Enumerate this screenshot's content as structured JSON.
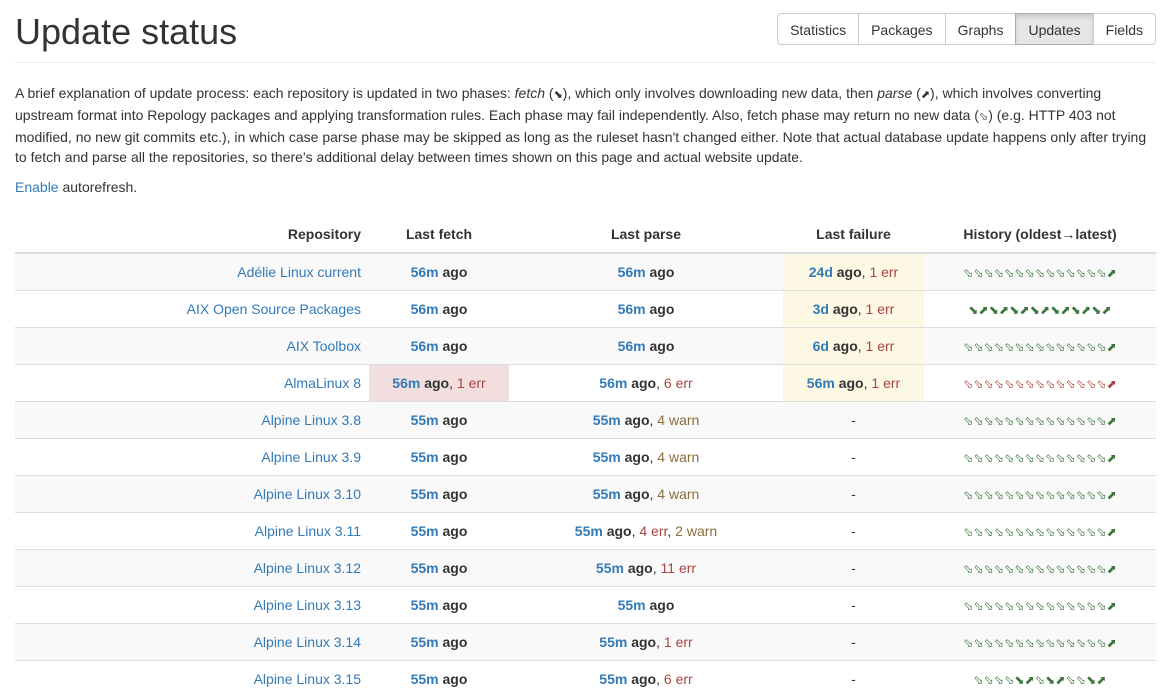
{
  "header": {
    "title": "Update status",
    "nav": [
      {
        "label": "Statistics",
        "active": false
      },
      {
        "label": "Packages",
        "active": false
      },
      {
        "label": "Graphs",
        "active": false
      },
      {
        "label": "Updates",
        "active": true
      },
      {
        "label": "Fields",
        "active": false
      }
    ]
  },
  "intro": {
    "p1": "A brief explanation of update process: each repository is updated in two phases: ",
    "fetch": "fetch",
    "p2": " (",
    "fetch_glyph": "⬊",
    "p3": "), which only involves downloading new data, then ",
    "parse": "parse",
    "p4": " (",
    "parse_glyph": "⬈",
    "p5": "), which involves converting upstream format into Repology packages and applying transformation rules. Each phase may fail independently. Also, fetch phase may return no new data (",
    "nodata_glyph": "⬂",
    "p6": ") (e.g. HTTP 403 not modified, no new git commits etc.), in which case parse phase may be skipped as long as the ruleset hasn't changed either. Note that actual database update happens only after trying to fetch and parse all the repositories, so there's additional delay between times shown on this page and actual website update."
  },
  "autorefresh": {
    "link": "Enable",
    "text": " autorefresh."
  },
  "table": {
    "headers": {
      "repo": "Repository",
      "fetch": "Last fetch",
      "parse": "Last parse",
      "failure": "Last failure",
      "history": "History (oldest→latest)"
    },
    "ago": "ago",
    "dash": "-",
    "rows": [
      {
        "repo": "Adélie Linux current",
        "fetch": {
          "t": "56m",
          "extra": []
        },
        "parse": {
          "t": "56m",
          "extra": []
        },
        "failure": {
          "t": "24d",
          "extra": [
            {
              "text": "1 err",
              "kind": "err"
            }
          ]
        },
        "failure_state": "warn",
        "fetch_state": "",
        "history": "⬂⬂⬂⬂⬂⬂⬂⬂⬂⬂⬂⬂⬂⬂⬈",
        "history_color": "ok"
      },
      {
        "repo": "AIX Open Source Packages",
        "fetch": {
          "t": "56m",
          "extra": []
        },
        "parse": {
          "t": "56m",
          "extra": []
        },
        "failure": {
          "t": "3d",
          "extra": [
            {
              "text": "1 err",
              "kind": "err"
            }
          ]
        },
        "failure_state": "warn",
        "fetch_state": "",
        "history": "⬊⬈⬊⬈⬊⬈⬊⬈⬊⬈⬊⬈⬊⬈",
        "history_color": "ok"
      },
      {
        "repo": "AIX Toolbox",
        "fetch": {
          "t": "56m",
          "extra": []
        },
        "parse": {
          "t": "56m",
          "extra": []
        },
        "failure": {
          "t": "6d",
          "extra": [
            {
              "text": "1 err",
              "kind": "err"
            }
          ]
        },
        "failure_state": "warn",
        "fetch_state": "",
        "history": "⬂⬂⬂⬂⬂⬂⬂⬂⬂⬂⬂⬂⬂⬂⬈",
        "history_color": "ok"
      },
      {
        "repo": "AlmaLinux 8",
        "fetch": {
          "t": "56m",
          "extra": [
            {
              "text": "1 err",
              "kind": "err"
            }
          ]
        },
        "parse": {
          "t": "56m",
          "extra": [
            {
              "text": "6 err",
              "kind": "err"
            }
          ]
        },
        "failure": {
          "t": "56m",
          "extra": [
            {
              "text": "1 err",
              "kind": "err"
            }
          ]
        },
        "failure_state": "warn",
        "fetch_state": "danger",
        "history": "⬂⬂⬂⬂⬂⬂⬂⬂⬂⬂⬂⬂⬂⬂⬈",
        "history_color": "bad"
      },
      {
        "repo": "Alpine Linux 3.8",
        "fetch": {
          "t": "55m",
          "extra": []
        },
        "parse": {
          "t": "55m",
          "extra": [
            {
              "text": "4 warn",
              "kind": "warn"
            }
          ]
        },
        "failure": null,
        "failure_state": "",
        "fetch_state": "",
        "history": "⬂⬂⬂⬂⬂⬂⬂⬂⬂⬂⬂⬂⬂⬂⬈",
        "history_color": "ok"
      },
      {
        "repo": "Alpine Linux 3.9",
        "fetch": {
          "t": "55m",
          "extra": []
        },
        "parse": {
          "t": "55m",
          "extra": [
            {
              "text": "4 warn",
              "kind": "warn"
            }
          ]
        },
        "failure": null,
        "failure_state": "",
        "fetch_state": "",
        "history": "⬂⬂⬂⬂⬂⬂⬂⬂⬂⬂⬂⬂⬂⬂⬈",
        "history_color": "ok"
      },
      {
        "repo": "Alpine Linux 3.10",
        "fetch": {
          "t": "55m",
          "extra": []
        },
        "parse": {
          "t": "55m",
          "extra": [
            {
              "text": "4 warn",
              "kind": "warn"
            }
          ]
        },
        "failure": null,
        "failure_state": "",
        "fetch_state": "",
        "history": "⬂⬂⬂⬂⬂⬂⬂⬂⬂⬂⬂⬂⬂⬂⬈",
        "history_color": "ok"
      },
      {
        "repo": "Alpine Linux 3.11",
        "fetch": {
          "t": "55m",
          "extra": []
        },
        "parse": {
          "t": "55m",
          "extra": [
            {
              "text": "4 err",
              "kind": "err"
            },
            {
              "text": "2 warn",
              "kind": "warn"
            }
          ]
        },
        "failure": null,
        "failure_state": "",
        "fetch_state": "",
        "history": "⬂⬂⬂⬂⬂⬂⬂⬂⬂⬂⬂⬂⬂⬂⬈",
        "history_color": "ok"
      },
      {
        "repo": "Alpine Linux 3.12",
        "fetch": {
          "t": "55m",
          "extra": []
        },
        "parse": {
          "t": "55m",
          "extra": [
            {
              "text": "11 err",
              "kind": "err"
            }
          ]
        },
        "failure": null,
        "failure_state": "",
        "fetch_state": "",
        "history": "⬂⬂⬂⬂⬂⬂⬂⬂⬂⬂⬂⬂⬂⬂⬈",
        "history_color": "ok"
      },
      {
        "repo": "Alpine Linux 3.13",
        "fetch": {
          "t": "55m",
          "extra": []
        },
        "parse": {
          "t": "55m",
          "extra": []
        },
        "failure": null,
        "failure_state": "",
        "fetch_state": "",
        "history": "⬂⬂⬂⬂⬂⬂⬂⬂⬂⬂⬂⬂⬂⬂⬈",
        "history_color": "ok"
      },
      {
        "repo": "Alpine Linux 3.14",
        "fetch": {
          "t": "55m",
          "extra": []
        },
        "parse": {
          "t": "55m",
          "extra": [
            {
              "text": "1 err",
              "kind": "err"
            }
          ]
        },
        "failure": null,
        "failure_state": "",
        "fetch_state": "",
        "history": "⬂⬂⬂⬂⬂⬂⬂⬂⬂⬂⬂⬂⬂⬂⬈",
        "history_color": "ok"
      },
      {
        "repo": "Alpine Linux 3.15",
        "fetch": {
          "t": "55m",
          "extra": []
        },
        "parse": {
          "t": "55m",
          "extra": [
            {
              "text": "6 err",
              "kind": "err"
            }
          ]
        },
        "failure": null,
        "failure_state": "",
        "fetch_state": "",
        "history": "⬂⬂⬂⬂⬊⬈⬂⬊⬈⬂⬂⬊⬈",
        "history_color": "ok"
      }
    ]
  }
}
